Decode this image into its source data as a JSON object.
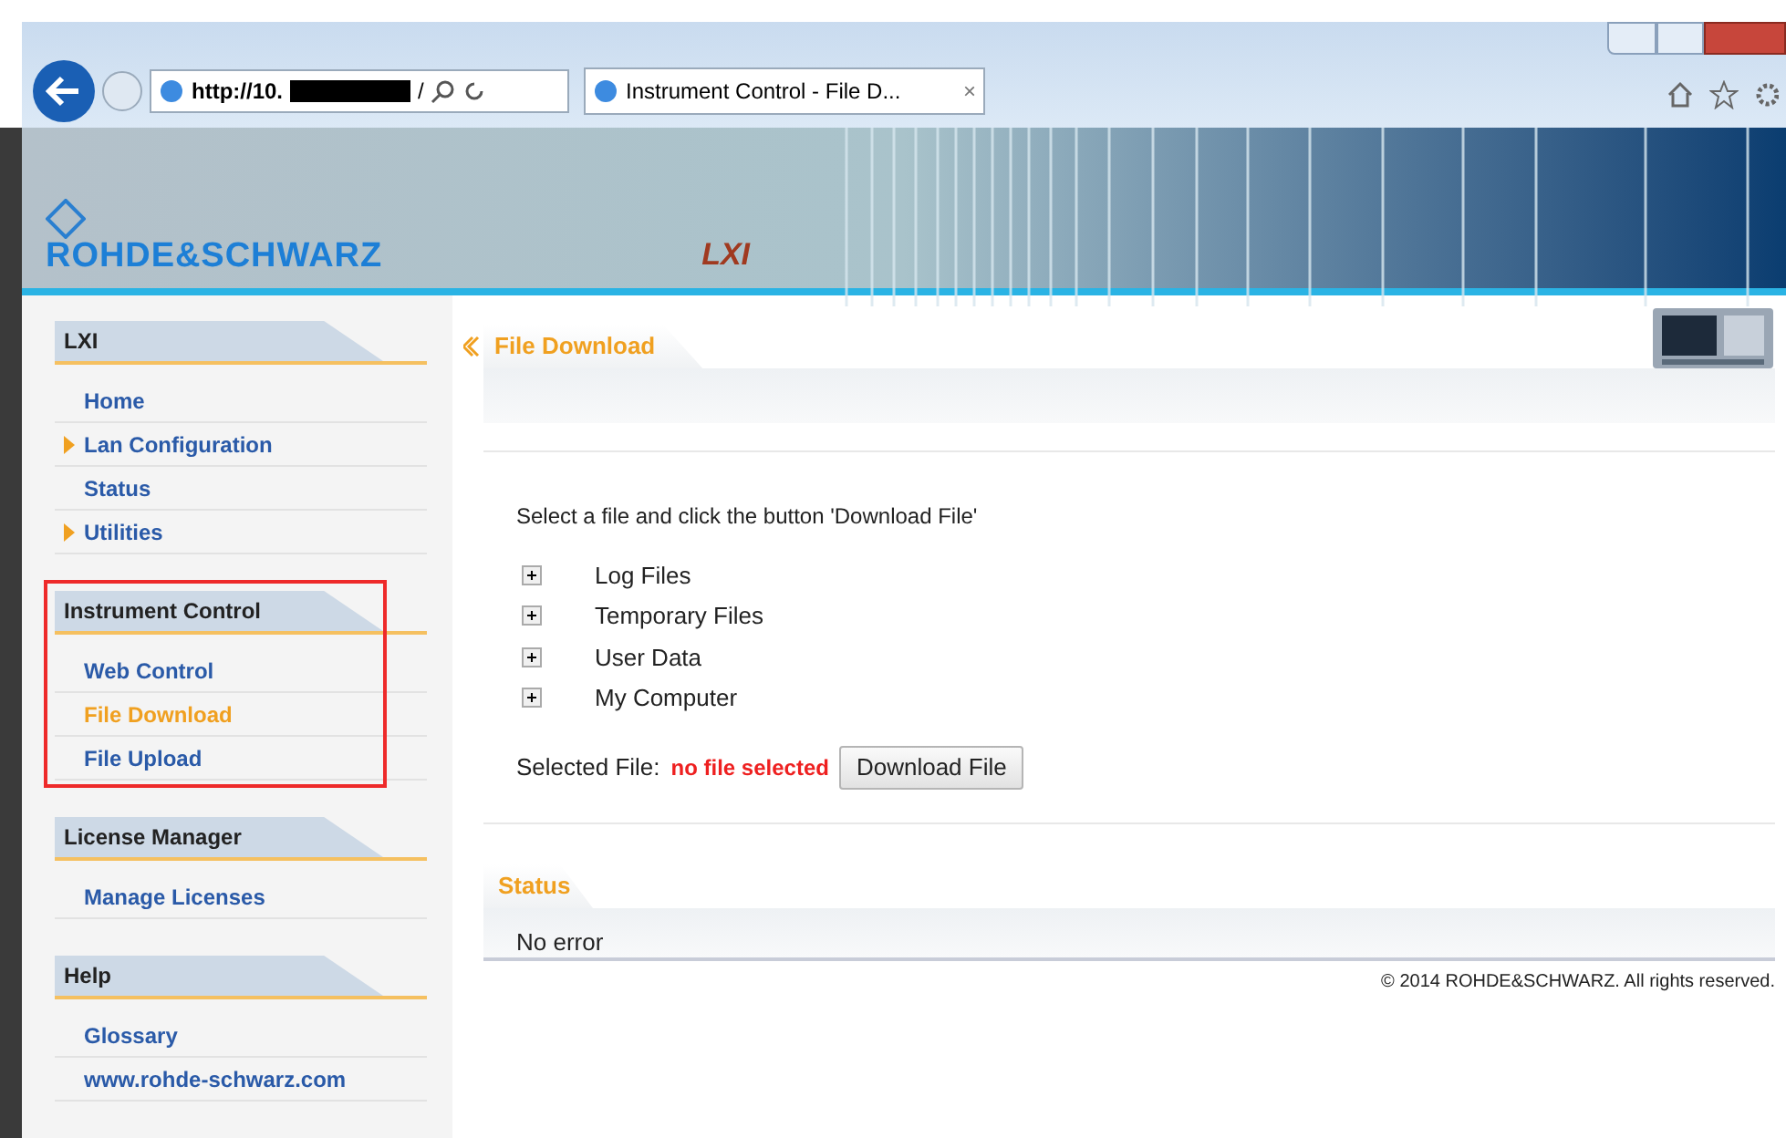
{
  "browser": {
    "address_prefix": "http://10.",
    "address_suffix": "/",
    "tab_title": "Instrument Control - File D...",
    "tab_close": "×"
  },
  "header": {
    "logo_text": "ROHDE&SCHWARZ",
    "lxi_logo": "LXI"
  },
  "sidebar": {
    "sections": [
      {
        "title": "LXI",
        "highlighted": false,
        "items": [
          {
            "label": "Home",
            "has_submenu": false,
            "selected": false
          },
          {
            "label": "Lan Configuration",
            "has_submenu": true,
            "selected": false
          },
          {
            "label": "Status",
            "has_submenu": false,
            "selected": false
          },
          {
            "label": "Utilities",
            "has_submenu": true,
            "selected": false
          }
        ]
      },
      {
        "title": "Instrument Control",
        "highlighted": true,
        "items": [
          {
            "label": "Web Control",
            "has_submenu": false,
            "selected": false
          },
          {
            "label": "File Download",
            "has_submenu": false,
            "selected": true
          },
          {
            "label": "File Upload",
            "has_submenu": false,
            "selected": false
          }
        ]
      },
      {
        "title": "License Manager",
        "highlighted": false,
        "items": [
          {
            "label": "Manage Licenses",
            "has_submenu": false,
            "selected": false
          }
        ]
      },
      {
        "title": "Help",
        "highlighted": false,
        "items": [
          {
            "label": "Glossary",
            "has_submenu": false,
            "selected": false
          },
          {
            "label": "www.rohde-schwarz.com",
            "has_submenu": false,
            "selected": false
          }
        ]
      }
    ]
  },
  "main": {
    "title": "File Download",
    "instruction": "Select a file and click the button 'Download File'",
    "tree": [
      {
        "label": "Log Files",
        "expanded": false
      },
      {
        "label": "Temporary Files",
        "expanded": false
      },
      {
        "label": "User Data",
        "expanded": false
      },
      {
        "label": "My Computer",
        "expanded": false
      }
    ],
    "selected_label": "Selected File:",
    "selected_value": "no file selected",
    "button": "Download File",
    "status_title": "Status",
    "status_text": "No error",
    "copyright": "© 2014 ROHDE&SCHWARZ. All rights reserved."
  }
}
